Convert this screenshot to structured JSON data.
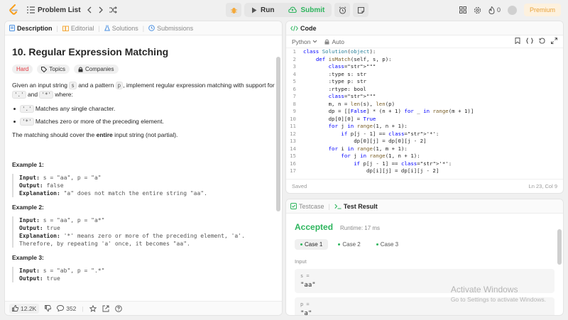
{
  "topbar": {
    "problem_list": "Problem List",
    "run_label": "Run",
    "submit_label": "Submit",
    "points": "0",
    "premium_label": "Premium"
  },
  "left_tabs": [
    {
      "label": "Description"
    },
    {
      "label": "Editorial"
    },
    {
      "label": "Solutions"
    },
    {
      "label": "Submissions"
    }
  ],
  "problem": {
    "title": "10. Regular Expression Matching",
    "difficulty": "Hard",
    "tag_topics": "Topics",
    "tag_companies": "Companies",
    "intro_1": "Given an input string ",
    "intro_s": "s",
    "intro_2": " and a pattern ",
    "intro_p": "p",
    "intro_3": ", implement regular expression matching with support for ",
    "intro_dot": "'.'",
    "intro_and": " and ",
    "intro_star": "'*'",
    "intro_4": " where:",
    "bullets": [
      {
        "code": "'.'",
        "text": " Matches any single character."
      },
      {
        "code": "'*'",
        "text": " Matches zero or more of the preceding element."
      }
    ],
    "cover_1": "The matching should cover the ",
    "cover_bold": "entire",
    "cover_2": " input string (not partial).",
    "examples": [
      {
        "title": "Example 1:",
        "input_label": "Input:",
        "input": " s = \"aa\", p = \"a\"",
        "output_label": "Output:",
        "output": " false",
        "expl_label": "Explanation:",
        "expl": " \"a\" does not match the entire string \"aa\".",
        "expl2": ""
      },
      {
        "title": "Example 2:",
        "input_label": "Input:",
        "input": " s = \"aa\", p = \"a*\"",
        "output_label": "Output:",
        "output": " true",
        "expl_label": "Explanation:",
        "expl": " '*' means zero or more of the preceding element, 'a'.",
        "expl2": "Therefore, by repeating 'a' once, it becomes \"aa\"."
      },
      {
        "title": "Example 3:",
        "input_label": "Input:",
        "input": " s = \"ab\", p = \".*\"",
        "output_label": "Output:",
        "output": " true",
        "expl_label": "",
        "expl": "",
        "expl2": ""
      }
    ]
  },
  "left_bottom": {
    "likes": "12.2K",
    "comments": "352"
  },
  "code_panel": {
    "tab_label": "Code",
    "language": "Python",
    "mode": "Auto",
    "status_saved": "Saved",
    "status_pos": "Ln 23, Col 9"
  },
  "code_lines": [
    {
      "n": "1",
      "t": "class Solution(object):"
    },
    {
      "n": "2",
      "t": "    def isMatch(self, s, p):"
    },
    {
      "n": "3",
      "t": "        \"\"\""
    },
    {
      "n": "4",
      "t": "        :type s: str"
    },
    {
      "n": "5",
      "t": "        :type p: str"
    },
    {
      "n": "6",
      "t": "        :rtype: bool"
    },
    {
      "n": "7",
      "t": "        \"\"\""
    },
    {
      "n": "8",
      "t": "        m, n = len(s), len(p)"
    },
    {
      "n": "9",
      "t": "        dp = [[False] * (n + 1) for _ in range(m + 1)]"
    },
    {
      "n": "10",
      "t": "        dp[0][0] = True"
    },
    {
      "n": "11",
      "t": "        for j in range(1, n + 1):"
    },
    {
      "n": "12",
      "t": "            if p[j - 1] == '*':"
    },
    {
      "n": "13",
      "t": "                dp[0][j] = dp[0][j - 2]"
    },
    {
      "n": "14",
      "t": "        for i in range(1, m + 1):"
    },
    {
      "n": "15",
      "t": "            for j in range(1, n + 1):"
    },
    {
      "n": "16",
      "t": "                if p[j - 1] == '*':"
    },
    {
      "n": "17",
      "t": "                    dp[i][j] = dp[i][j - 2]"
    }
  ],
  "test_panel": {
    "tab_testcase": "Testcase",
    "tab_result": "Test Result",
    "accepted": "Accepted",
    "runtime": "Runtime: 17 ms",
    "cases": [
      "Case 1",
      "Case 2",
      "Case 3"
    ],
    "input_label": "Input",
    "field_s_key": "s =",
    "field_s_val": "\"aa\"",
    "field_p_key": "p =",
    "field_p_val": "\"a\""
  },
  "watermark": {
    "line1": "Activate Windows",
    "line2": "Go to Settings to activate Windows."
  }
}
